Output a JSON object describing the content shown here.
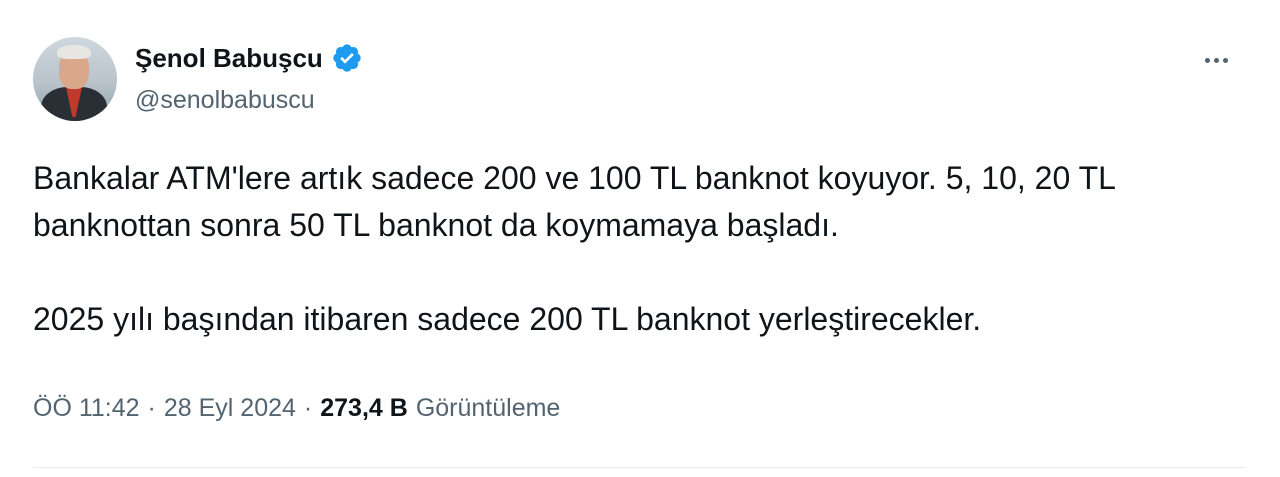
{
  "author": {
    "display_name": "Şenol Babuşcu",
    "handle": "@senolbabuscu",
    "verified": true,
    "badge_color": "#1d9bf0"
  },
  "tweet": {
    "paragraph_1": "Bankalar ATM'lere artık sadece 200 ve 100 TL banknot koyuyor.  5, 10, 20 TL banknottan sonra 50 TL banknot da koymamaya başladı.",
    "paragraph_2": "2025 yılı başından itibaren sadece 200 TL banknot yerleştirecekler."
  },
  "meta": {
    "time": "ÖÖ 11:42",
    "separator": "·",
    "date": "28 Eyl 2024",
    "views_count": "273,4 B",
    "views_label": "Görüntüleme"
  },
  "icons": {
    "verified": "verified-badge-icon",
    "more": "more-options-icon"
  }
}
